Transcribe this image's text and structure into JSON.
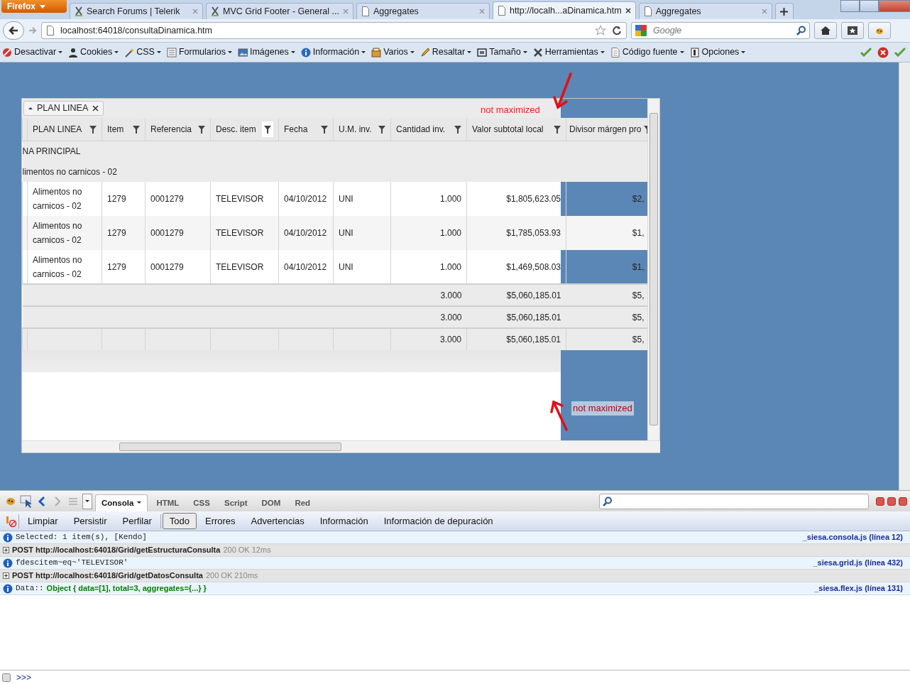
{
  "browser": {
    "app_button": "Firefox",
    "tabs": [
      {
        "title": "Search Forums | Telerik",
        "kind": "site",
        "selected": false
      },
      {
        "title": "MVC Grid Footer - General ...",
        "kind": "site",
        "selected": false
      },
      {
        "title": "Aggregates",
        "kind": "page",
        "selected": false
      },
      {
        "title": "http://localh...aDinamica.htm",
        "kind": "page",
        "selected": true
      },
      {
        "title": "Aggregates",
        "kind": "page",
        "selected": false
      }
    ],
    "address": "localhost:64018/consultaDinamica.htm",
    "search": {
      "placeholder": "Google"
    }
  },
  "webdev_toolbar": {
    "items": [
      "Desactivar",
      "Cookies",
      "CSS",
      "Formularios",
      "Imágenes",
      "Información",
      "Varios",
      "Resaltar",
      "Tamaño",
      "Herramientas",
      "Código fuente",
      "Opciones"
    ]
  },
  "grid": {
    "group_tag": "PLAN LINEA",
    "columns": [
      "PLAN LINEA",
      "Item",
      "Referencia",
      "Desc. item",
      "Fecha",
      "U.M. inv.",
      "Cantidad inv.",
      "Valor subtotal local",
      "Divisor márgen pro"
    ],
    "group_rows": [
      "NA PRINCIPAL",
      "limentos no carnicos - 02"
    ],
    "rows": [
      {
        "cells": [
          "Alimentos no carnicos - 02",
          "1279",
          "0001279",
          "TELEVISOR",
          "04/10/2012",
          "UNI",
          "1.000",
          "$1,805,623.05",
          "$2,"
        ]
      },
      {
        "cells": [
          "Alimentos no carnicos - 02",
          "1279",
          "0001279",
          "TELEVISOR",
          "04/10/2012",
          "UNI",
          "1.000",
          "$1,785,053.93",
          "$1,"
        ]
      },
      {
        "cells": [
          "Alimentos no carnicos - 02",
          "1279",
          "0001279",
          "TELEVISOR",
          "04/10/2012",
          "UNI",
          "1.000",
          "$1,469,508.03",
          "$1,"
        ]
      }
    ],
    "footers": [
      {
        "kind": "group",
        "cells": [
          "3.000",
          "$5,060,185.01",
          "$5,"
        ]
      },
      {
        "kind": "group",
        "cells": [
          "3.000",
          "$5,060,185.01",
          "$5,"
        ]
      },
      {
        "kind": "grid",
        "cells": [
          "3.000",
          "$5,060,185.01",
          "$5,"
        ]
      }
    ]
  },
  "annotations": [
    "not maximized",
    "not maximized"
  ],
  "firebug": {
    "tabs": [
      {
        "label": "Consola",
        "selected": true
      },
      {
        "label": "HTML",
        "selected": false
      },
      {
        "label": "CSS",
        "selected": false
      },
      {
        "label": "Script",
        "selected": false
      },
      {
        "label": "DOM",
        "selected": false
      },
      {
        "label": "Red",
        "selected": false
      }
    ],
    "actions": [
      "Limpiar",
      "Persistir",
      "Perfilar"
    ],
    "filters": [
      {
        "label": "Todo",
        "selected": true
      },
      {
        "label": "Errores",
        "selected": false
      },
      {
        "label": "Advertencias",
        "selected": false
      },
      {
        "label": "Información",
        "selected": false
      },
      {
        "label": "Información de depuración",
        "selected": false
      }
    ],
    "log": [
      {
        "kind": "info",
        "text": "Selected: 1 item(s), [Kendo]",
        "source": "_siesa.consola.js (línea 12)"
      },
      {
        "kind": "request",
        "text": "POST http://localhost:64018/Grid/getEstructuraConsulta",
        "status": "200 OK 12ms"
      },
      {
        "kind": "info",
        "text": "fdescitem~eq~'TELEVISOR'",
        "source": "_siesa.grid.js (línea 432)"
      },
      {
        "kind": "request",
        "text": "POST http://localhost:64018/Grid/getDatosConsulta",
        "status": "200 OK 210ms"
      },
      {
        "kind": "object",
        "prefix": "Data::",
        "text": "Object { data=[1], total=3, aggregates={...} }",
        "source": "_siesa.flex.js (línea 131)"
      }
    ],
    "command_prompt": ">>>"
  }
}
